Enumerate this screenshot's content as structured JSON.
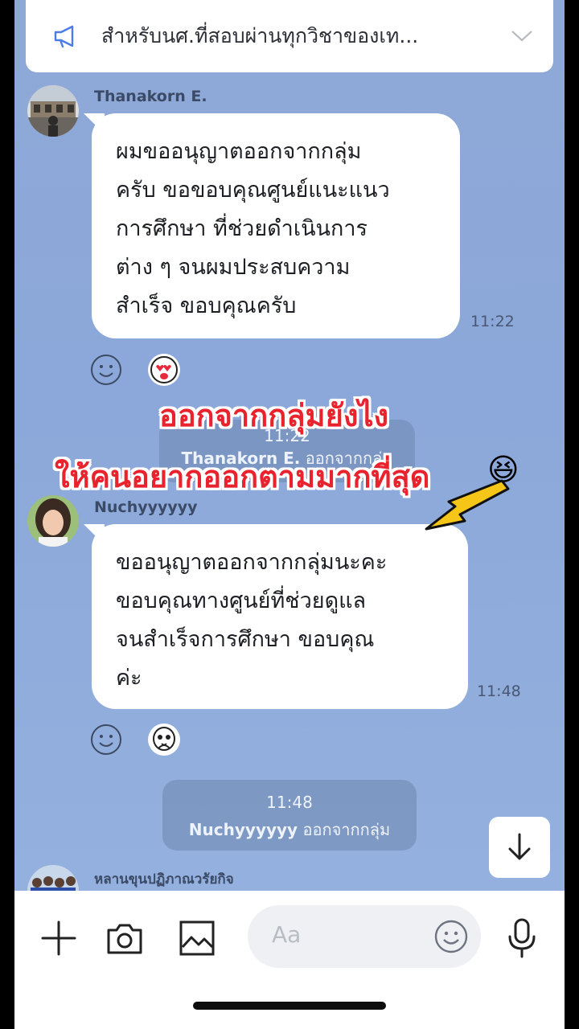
{
  "announcement": {
    "text": "สำหรับนศ.ที่สอบผ่านทุกวิชาของเท..."
  },
  "messages": [
    {
      "sender": "Thanakorn E.",
      "lines": [
        "ผมขออนุญาตออกจากกลุ่ม",
        "ครับ ขอขอบคุณศูนย์แนะแนว",
        "การศึกษา ที่ช่วยดำเนินการ",
        "ต่าง ๆ จนผมประสบความ",
        "สำเร็จ ขอบคุณครับ"
      ],
      "time": "11:22"
    },
    {
      "sender": "Nuchyyyyyy",
      "lines": [
        "ขออนุญาตออกจากกลุ่มนะคะ",
        "ขอบคุณทางศูนย์ที่ช่วยดูแล",
        "จนสำเร็จการศึกษา ขอบคุณ",
        "ค่ะ"
      ],
      "time": "11:48"
    }
  ],
  "system_notices": [
    {
      "time": "11:22",
      "name": "Thanakorn E.",
      "action": "ออกจากกลุ่ม"
    },
    {
      "time": "11:48",
      "name": "Nuchyyyyyy",
      "action": "ออกจากกลุ่ม"
    }
  ],
  "next_sender": {
    "name": "หลานขุนปฏิภาณวรัยกิจ"
  },
  "overlay": {
    "line1": "ออกจากกลุ่มยังไง",
    "line2": "ให้คนอยากออกตามมากที่สุด",
    "emoji": "😆"
  },
  "composer": {
    "placeholder": "Aa"
  },
  "colors": {
    "chat_bg": "#8ea9d6",
    "overlay_text": "#e8232e",
    "arrow": "#f5c518"
  },
  "icons": [
    "megaphone-icon",
    "chevron-down-icon",
    "smiley-icon",
    "heart-eyes-emoji",
    "pleading-emoji",
    "arrow-down-icon",
    "plus-icon",
    "camera-icon",
    "image-icon",
    "emoji-icon",
    "mic-icon"
  ]
}
